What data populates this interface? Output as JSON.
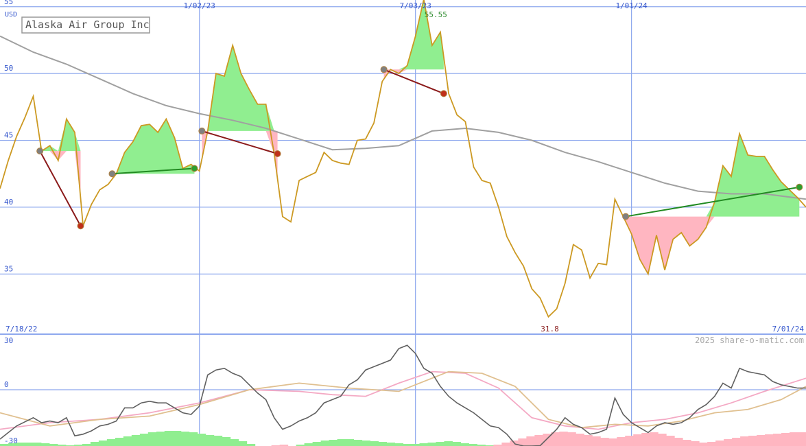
{
  "chart_data": {
    "type": "line",
    "title": "Alaska Air Group Inc",
    "currency_label": "USD",
    "copyright": "2025 share-o-matic.com",
    "grid": true,
    "colors": {
      "price": "#cc9922",
      "moving_average": "#a0a0a0",
      "gain_fill": "#90ee90",
      "loss_fill": "#ffb6c1",
      "gain_line": "#228b22",
      "loss_line": "#8b1a1a",
      "grid": "#8ea8ee",
      "divider": "#8ea8ee"
    },
    "price_panel": {
      "ylim": [
        30.5,
        55.5
      ],
      "yticks": [
        35,
        40,
        45,
        50,
        55
      ],
      "date_ticks": [
        {
          "label": "1/02/23",
          "x": 24
        },
        {
          "label": "7/03/23",
          "x": 50
        },
        {
          "label": "1/01/24",
          "x": 76
        }
      ],
      "start_label": "7/18/22",
      "end_label": "7/01/24",
      "high": {
        "value": 55.55,
        "label": "55.55",
        "x": 51
      },
      "low": {
        "value": 31.8,
        "label": "31.8",
        "x": 66
      },
      "price": [
        [
          0,
          41.4
        ],
        [
          1,
          43.5
        ],
        [
          2,
          45.3
        ],
        [
          3,
          46.7
        ],
        [
          4,
          48.3
        ],
        [
          5,
          44.2
        ],
        [
          6,
          44.6
        ],
        [
          7,
          43.5
        ],
        [
          8,
          46.6
        ],
        [
          9,
          45.6
        ],
        [
          10,
          38.6
        ],
        [
          11,
          40.2
        ],
        [
          12,
          41.3
        ],
        [
          13,
          41.7
        ],
        [
          14,
          42.5
        ],
        [
          15,
          44.1
        ],
        [
          16,
          44.9
        ],
        [
          17,
          46.1
        ],
        [
          18,
          46.2
        ],
        [
          19,
          45.6
        ],
        [
          20,
          46.6
        ],
        [
          21,
          45.2
        ],
        [
          22,
          42.9
        ],
        [
          23,
          43.2
        ],
        [
          24,
          42.7
        ],
        [
          25,
          45.7
        ],
        [
          26,
          50.0
        ],
        [
          27,
          49.8
        ],
        [
          28,
          52.1
        ],
        [
          29,
          50.0
        ],
        [
          30,
          48.8
        ],
        [
          31,
          47.7
        ],
        [
          32,
          47.7
        ],
        [
          33,
          44.0
        ],
        [
          34,
          39.3
        ],
        [
          35,
          38.9
        ],
        [
          36,
          42.0
        ],
        [
          37,
          42.3
        ],
        [
          38,
          42.6
        ],
        [
          39,
          44.1
        ],
        [
          40,
          43.5
        ],
        [
          41,
          43.3
        ],
        [
          42,
          43.2
        ],
        [
          43,
          45.0
        ],
        [
          44,
          45.1
        ],
        [
          45,
          46.3
        ],
        [
          46,
          49.4
        ],
        [
          47,
          50.3
        ],
        [
          48,
          50.0
        ],
        [
          49,
          50.6
        ],
        [
          50,
          52.8
        ],
        [
          51,
          55.55
        ],
        [
          52,
          52.1
        ],
        [
          53,
          53.1
        ],
        [
          54,
          48.5
        ],
        [
          55,
          46.9
        ],
        [
          56,
          46.4
        ],
        [
          57,
          43.0
        ],
        [
          58,
          42.0
        ],
        [
          59,
          41.8
        ],
        [
          60,
          40.0
        ],
        [
          61,
          37.8
        ],
        [
          62,
          36.6
        ],
        [
          63,
          35.6
        ],
        [
          64,
          33.9
        ],
        [
          65,
          33.2
        ],
        [
          66,
          31.8
        ],
        [
          67,
          32.4
        ],
        [
          68,
          34.3
        ],
        [
          69,
          37.2
        ],
        [
          70,
          36.8
        ],
        [
          71,
          34.7
        ],
        [
          72,
          35.8
        ],
        [
          73,
          35.7
        ],
        [
          74,
          40.6
        ],
        [
          75,
          39.3
        ],
        [
          76,
          38.0
        ],
        [
          77,
          36.1
        ],
        [
          78,
          35.0
        ],
        [
          79,
          37.9
        ],
        [
          80,
          35.3
        ],
        [
          81,
          37.6
        ],
        [
          82,
          38.1
        ],
        [
          83,
          37.1
        ],
        [
          84,
          37.6
        ],
        [
          85,
          38.5
        ],
        [
          86,
          40.4
        ],
        [
          87,
          43.1
        ],
        [
          88,
          42.3
        ],
        [
          89,
          45.5
        ],
        [
          90,
          43.9
        ],
        [
          91,
          43.8
        ],
        [
          92,
          43.8
        ],
        [
          93,
          42.8
        ],
        [
          94,
          41.9
        ],
        [
          95,
          41.3
        ],
        [
          96,
          40.7
        ],
        [
          97,
          40.0
        ]
      ],
      "moving_average": [
        [
          0,
          52.8
        ],
        [
          4,
          51.6
        ],
        [
          8,
          50.7
        ],
        [
          12,
          49.6
        ],
        [
          16,
          48.5
        ],
        [
          20,
          47.6
        ],
        [
          24,
          47.0
        ],
        [
          28,
          46.5
        ],
        [
          32,
          45.9
        ],
        [
          36,
          45.1
        ],
        [
          40,
          44.3
        ],
        [
          44,
          44.4
        ],
        [
          48,
          44.6
        ],
        [
          52,
          45.7
        ],
        [
          56,
          45.9
        ],
        [
          60,
          45.6
        ],
        [
          64,
          45.0
        ],
        [
          68,
          44.1
        ],
        [
          72,
          43.4
        ],
        [
          76,
          42.6
        ],
        [
          80,
          41.8
        ],
        [
          84,
          41.2
        ],
        [
          88,
          41.0
        ],
        [
          92,
          41.0
        ],
        [
          97,
          40.6
        ]
      ],
      "trades": [
        {
          "result": "loss",
          "start": [
            4.8,
            44.2
          ],
          "end": [
            9.7,
            38.6
          ]
        },
        {
          "result": "gain",
          "start": [
            13.5,
            42.5
          ],
          "end": [
            23.4,
            42.9
          ]
        },
        {
          "result": "loss",
          "start": [
            24.3,
            45.7
          ],
          "end": [
            33.4,
            44.0
          ]
        },
        {
          "result": "loss",
          "start": [
            46.2,
            50.3
          ],
          "end": [
            53.4,
            48.5
          ]
        },
        {
          "result": "gain",
          "start": [
            75.3,
            39.3
          ],
          "end": [
            96.2,
            41.5
          ]
        }
      ]
    },
    "oscillator_panel": {
      "ylim": [
        -30,
        30
      ],
      "yticks": [
        30,
        0,
        -30
      ],
      "oscillator": [
        [
          0,
          -30
        ],
        [
          2,
          -22
        ],
        [
          4,
          -17
        ],
        [
          5,
          -20
        ],
        [
          6,
          -19
        ],
        [
          7,
          -20
        ],
        [
          8,
          -17
        ],
        [
          9,
          -28
        ],
        [
          10,
          -27
        ],
        [
          11,
          -25
        ],
        [
          12,
          -22
        ],
        [
          13,
          -21
        ],
        [
          14,
          -19
        ],
        [
          15,
          -11
        ],
        [
          16,
          -11
        ],
        [
          17,
          -8
        ],
        [
          18,
          -7
        ],
        [
          19,
          -8
        ],
        [
          20,
          -8
        ],
        [
          21,
          -11
        ],
        [
          22,
          -14
        ],
        [
          23,
          -15
        ],
        [
          24,
          -10
        ],
        [
          25,
          9
        ],
        [
          26,
          12
        ],
        [
          27,
          13
        ],
        [
          28,
          10
        ],
        [
          29,
          8
        ],
        [
          30,
          3
        ],
        [
          31,
          -2
        ],
        [
          32,
          -6
        ],
        [
          33,
          -17
        ],
        [
          34,
          -24
        ],
        [
          35,
          -22
        ],
        [
          36,
          -19
        ],
        [
          37,
          -17
        ],
        [
          38,
          -14
        ],
        [
          39,
          -8
        ],
        [
          40,
          -6
        ],
        [
          41,
          -4
        ],
        [
          42,
          3
        ],
        [
          43,
          6
        ],
        [
          44,
          12
        ],
        [
          45,
          14
        ],
        [
          46,
          16
        ],
        [
          47,
          18
        ],
        [
          48,
          25
        ],
        [
          49,
          27
        ],
        [
          50,
          22
        ],
        [
          51,
          13
        ],
        [
          52,
          10
        ],
        [
          53,
          2
        ],
        [
          54,
          -4
        ],
        [
          55,
          -8
        ],
        [
          56,
          -11
        ],
        [
          57,
          -14
        ],
        [
          58,
          -18
        ],
        [
          59,
          -22
        ],
        [
          60,
          -23
        ],
        [
          61,
          -27
        ],
        [
          62,
          -33
        ],
        [
          63,
          -35
        ],
        [
          64,
          -36
        ],
        [
          65,
          -34
        ],
        [
          66,
          -29
        ],
        [
          67,
          -24
        ],
        [
          68,
          -17
        ],
        [
          69,
          -21
        ],
        [
          70,
          -23
        ],
        [
          71,
          -27
        ],
        [
          72,
          -26
        ],
        [
          73,
          -24
        ],
        [
          74,
          -5
        ],
        [
          75,
          -15
        ],
        [
          76,
          -20
        ],
        [
          77,
          -23
        ],
        [
          78,
          -26
        ],
        [
          79,
          -22
        ],
        [
          80,
          -20
        ],
        [
          81,
          -21
        ],
        [
          82,
          -20
        ],
        [
          83,
          -17
        ],
        [
          84,
          -12
        ],
        [
          85,
          -9
        ],
        [
          86,
          -4
        ],
        [
          87,
          4
        ],
        [
          88,
          1
        ],
        [
          89,
          13
        ],
        [
          90,
          11
        ],
        [
          91,
          10
        ],
        [
          92,
          9
        ],
        [
          93,
          5
        ],
        [
          94,
          3
        ],
        [
          95,
          2
        ],
        [
          96,
          1
        ],
        [
          97,
          1
        ]
      ],
      "signal_pink": [
        [
          0,
          -24
        ],
        [
          6,
          -20
        ],
        [
          12,
          -18
        ],
        [
          18,
          -14
        ],
        [
          24,
          -8
        ],
        [
          30,
          0
        ],
        [
          36,
          -1
        ],
        [
          40,
          -3
        ],
        [
          44,
          -4
        ],
        [
          48,
          4
        ],
        [
          52,
          11
        ],
        [
          56,
          10
        ],
        [
          60,
          1
        ],
        [
          64,
          -17
        ],
        [
          68,
          -22
        ],
        [
          72,
          -24
        ],
        [
          76,
          -20
        ],
        [
          80,
          -18
        ],
        [
          84,
          -14
        ],
        [
          88,
          -8
        ],
        [
          92,
          -1
        ],
        [
          97,
          7
        ]
      ],
      "signal_tan": [
        [
          0,
          -14
        ],
        [
          6,
          -22
        ],
        [
          12,
          -18
        ],
        [
          18,
          -16
        ],
        [
          24,
          -9
        ],
        [
          30,
          0
        ],
        [
          36,
          4
        ],
        [
          42,
          1
        ],
        [
          48,
          -1
        ],
        [
          54,
          11
        ],
        [
          58,
          10
        ],
        [
          62,
          2
        ],
        [
          66,
          -18
        ],
        [
          70,
          -23
        ],
        [
          74,
          -21
        ],
        [
          78,
          -22
        ],
        [
          82,
          -19
        ],
        [
          86,
          -14
        ],
        [
          90,
          -12
        ],
        [
          94,
          -6
        ],
        [
          97,
          2
        ]
      ],
      "histogram": [
        0.6,
        0.8,
        1.0,
        1.0,
        1.0,
        0.8,
        0.6,
        0.4,
        0.2,
        0.4,
        0.6,
        1.2,
        1.6,
        2.0,
        2.4,
        2.8,
        3.2,
        3.6,
        4.0,
        4.2,
        4.4,
        4.4,
        4.2,
        4.0,
        3.6,
        3.2,
        3.0,
        2.6,
        2.0,
        1.4,
        0.6,
        0.0,
        0.0,
        -0.2,
        -0.4,
        0.0,
        0.4,
        0.8,
        1.2,
        1.6,
        1.8,
        2.0,
        2.0,
        1.8,
        1.6,
        1.4,
        1.2,
        1.0,
        0.8,
        0.6,
        0.6,
        0.8,
        1.0,
        1.2,
        1.4,
        1.2,
        0.8,
        0.6,
        0.4,
        0.2,
        -0.4,
        -1.0,
        -1.6,
        -2.2,
        -2.8,
        -3.2,
        -3.6,
        -4.0,
        -4.2,
        -4.0,
        -3.6,
        -3.2,
        -2.8,
        -2.4,
        -2.2,
        -2.6,
        -3.0,
        -3.4,
        -3.8,
        -4.0,
        -3.6,
        -3.0,
        -2.4,
        -1.8,
        -1.4,
        -1.0,
        -1.2,
        -1.6,
        -2.0,
        -2.4,
        -2.8,
        -3.0,
        -3.2,
        -3.4,
        -3.6,
        -3.8,
        -4.0,
        -4.0
      ]
    }
  }
}
